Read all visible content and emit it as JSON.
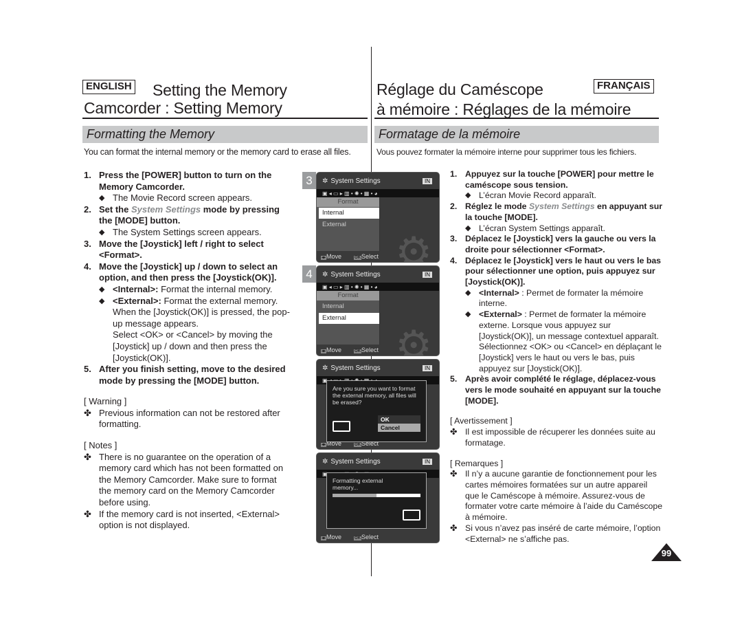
{
  "left": {
    "lang_label": "ENGLISH",
    "title_line1": "Setting the Memory",
    "title_line2": "Camcorder : Setting Memory",
    "section": "Formatting the Memory",
    "intro": "You can format the internal memory or the memory card to erase all files.",
    "steps": [
      {
        "n": "1.",
        "text": "Press the [POWER] button to turn on the Memory Camcorder.",
        "subs": [
          "The Movie Record screen appears."
        ]
      },
      {
        "n": "2.",
        "pre": "Set the ",
        "em": "System Settings",
        "post": " mode by pressing the [MODE] button.",
        "subs": [
          "The System Settings screen appears."
        ]
      },
      {
        "n": "3.",
        "text": "Move the [Joystick] left / right to select <Format>."
      },
      {
        "n": "4.",
        "text": "Move the [Joystick] up / down to select an option, and then press the [Joystick(OK)].",
        "subs": [
          {
            "b": "<Internal>:",
            "t": " Format the internal memory."
          },
          {
            "b": "<External>:",
            "t": "  Format the external memory. When the [Joystick(OK)] is pressed, the pop-up message appears."
          }
        ],
        "cont": "Select <OK> or <Cancel> by moving the [Joystick] up / down and then press the [Joystick(OK)]."
      },
      {
        "n": "5.",
        "text": "After you finish setting, move to the desired mode by pressing the [MODE] button."
      }
    ],
    "warning_title": "[ Warning ]",
    "warnings": [
      "Previous information can not be restored after formatting."
    ],
    "notes_title": "[ Notes ]",
    "notes": [
      "There is no guarantee on the operation of a memory card which has not been formatted on the Memory Camcorder. Make sure to format the memory card on the Memory Camcorder before using.",
      "If the memory card is not inserted, <External> option is not displayed."
    ]
  },
  "right": {
    "lang_label": "FRANÇAIS",
    "title_line1": "Réglage du Caméscope",
    "title_line2": "à mémoire : Réglages de la mémoire",
    "section": "Formatage de la mémoire",
    "intro": "Vous pouvez formater la mémoire interne pour supprimer tous les fichiers.",
    "steps": [
      {
        "n": "1.",
        "text": "Appuyez sur la touche [POWER] pour mettre le caméscope sous tension.",
        "subs": [
          "L’écran Movie Record apparaît."
        ]
      },
      {
        "n": "2.",
        "pre": "Réglez le mode ",
        "em": "System Settings",
        "post": " en appuyant sur la touche [MODE].",
        "subs": [
          "L’écran System Settings apparaît."
        ]
      },
      {
        "n": "3.",
        "text": "Déplacez le [Joystick] vers la gauche ou vers la droite pour sélectionner <Format>."
      },
      {
        "n": "4.",
        "text": "Déplacez le [Joystick] vers le haut ou vers le bas pour sélectionner une option, puis appuyez sur [Joystick(OK)].",
        "subs": [
          {
            "b": "<Internal>",
            "t": " : Permet de formater la mémoire interne."
          },
          {
            "b": "<External>",
            "t": " :  Permet de formater la mémoire externe. Lorsque vous appuyez sur [Joystick(OK)], un message contextuel apparaît."
          }
        ],
        "cont": "Sélectionnez <OK> ou <Cancel> en déplaçant le [Joystick] vers le haut ou vers le bas, puis appuyez sur [Joystick(OK)]."
      },
      {
        "n": "5.",
        "text": "Après avoir complété le réglage, déplacez-vous vers le mode souhaité en appuyant sur la touche [MODE]."
      }
    ],
    "warning_title": "[ Avertissement ]",
    "warnings": [
      "Il est impossible de récuperer les données suite au formatage."
    ],
    "notes_title": "[ Remarques ]",
    "notes": [
      "Il n’y a aucune garantie de fonctionnement pour les cartes mémoires formatées sur un autre appareil que le Caméscope à mémoire. Assurez-vous de formater votre carte mémoire à l’aide du Caméscope à mémoire.",
      "Si vous n’avez pas inséré de carte mémoire, l’option <External> ne s’affiche pas."
    ]
  },
  "bullet_icon": "diamond-icon",
  "note_icon": "cross-flower-icon",
  "screens": {
    "title": "System Settings",
    "battery": "IN",
    "menu_header": "Format",
    "options": [
      "Internal",
      "External"
    ],
    "move_label": "Move",
    "ok_key": "OK",
    "select_label": "Select",
    "step_badges": [
      "3",
      "4"
    ],
    "selected": [
      "Internal",
      "External"
    ],
    "confirm_text": "Are you sure you want to format the external memory, all files will be erased?",
    "confirm_ok": "OK",
    "confirm_cancel": "Cancel",
    "progress_text": "Formatting external memory...",
    "progress_percent": 50
  },
  "page_number": "99"
}
